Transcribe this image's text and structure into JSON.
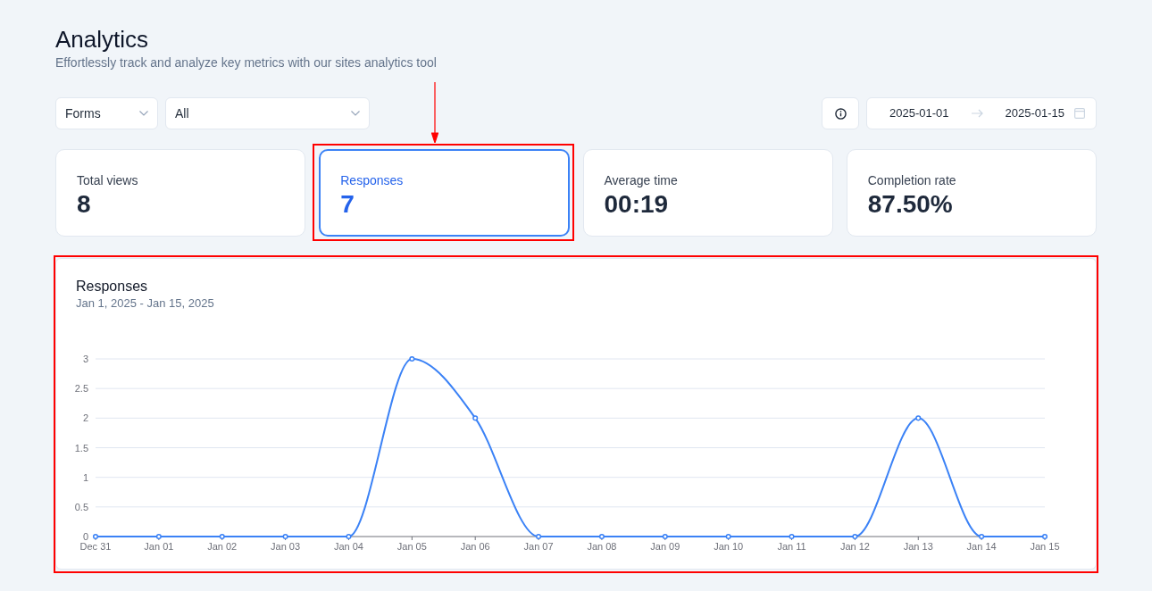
{
  "page": {
    "title": "Analytics",
    "subtitle": "Effortlessly track and analyze key metrics with our sites analytics tool"
  },
  "filters": [
    {
      "value": "Forms"
    },
    {
      "value": "All"
    }
  ],
  "date_range": {
    "start": "2025-01-01",
    "end": "2025-01-15"
  },
  "metrics": [
    {
      "label": "Total views",
      "value": "8",
      "selected": false,
      "annotated": false,
      "arrow": false
    },
    {
      "label": "Responses",
      "value": "7",
      "selected": true,
      "annotated": true,
      "arrow": true
    },
    {
      "label": "Average time",
      "value": "00:19",
      "selected": false,
      "annotated": false,
      "arrow": false
    },
    {
      "label": "Completion rate",
      "value": "87.50%",
      "selected": false,
      "annotated": false,
      "arrow": false
    }
  ],
  "chart_panel": {
    "annotated": true,
    "chart_data": [
      {
        "type": "line",
        "title": "Responses",
        "subtitle": "Jan 1, 2025 - Jan 15, 2025",
        "categories": [
          "Dec 31",
          "Jan 01",
          "Jan 02",
          "Jan 03",
          "Jan 04",
          "Jan 05",
          "Jan 06",
          "Jan 07",
          "Jan 08",
          "Jan 09",
          "Jan 10",
          "Jan 11",
          "Jan 12",
          "Jan 13",
          "Jan 14",
          "Jan 15"
        ],
        "values": [
          0,
          0,
          0,
          0,
          0,
          3,
          2,
          0,
          0,
          0,
          0,
          0,
          0,
          2,
          0,
          0
        ],
        "color": "#3b82f6",
        "ylim": [
          0,
          3
        ],
        "yticks": [
          0,
          0.5,
          1,
          1.5,
          2,
          2.5,
          3
        ],
        "grid": true,
        "marker": "circle"
      }
    ]
  }
}
